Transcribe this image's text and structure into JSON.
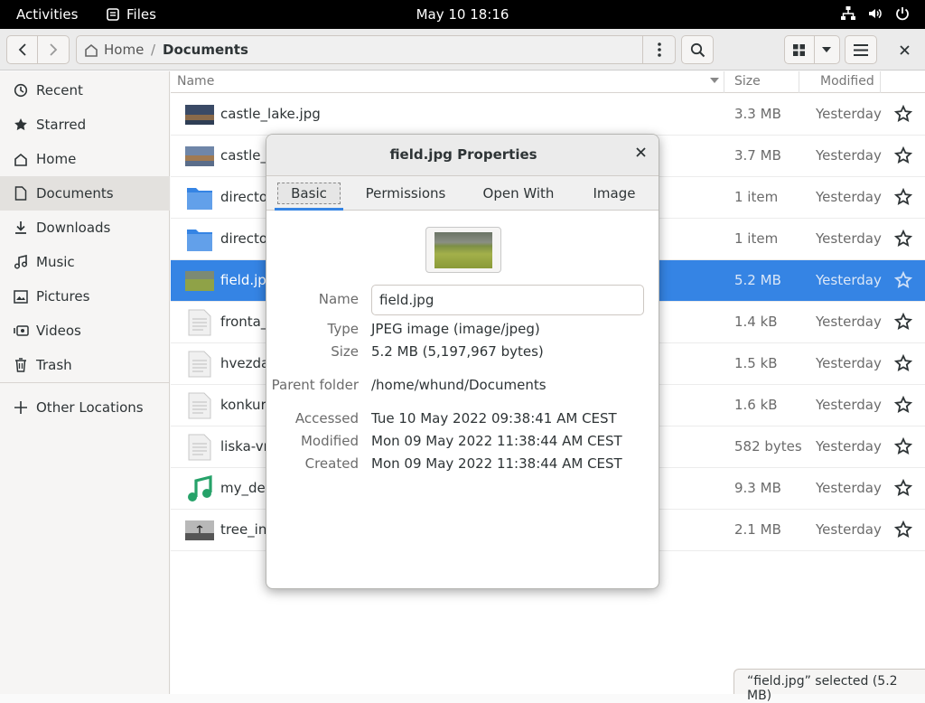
{
  "topbar": {
    "activities": "Activities",
    "app_name": "Files",
    "clock": "May 10  18:16"
  },
  "pathbar": {
    "home": "Home",
    "separator": "/",
    "current": "Documents"
  },
  "sidebar": {
    "items": [
      {
        "label": "Recent",
        "icon": "clock-icon"
      },
      {
        "label": "Starred",
        "icon": "star-icon"
      },
      {
        "label": "Home",
        "icon": "home-icon"
      },
      {
        "label": "Documents",
        "icon": "document-icon"
      },
      {
        "label": "Downloads",
        "icon": "download-icon"
      },
      {
        "label": "Music",
        "icon": "music-icon"
      },
      {
        "label": "Pictures",
        "icon": "picture-icon"
      },
      {
        "label": "Videos",
        "icon": "video-icon"
      },
      {
        "label": "Trash",
        "icon": "trash-icon"
      }
    ],
    "other_locations": "Other Locations"
  },
  "columns": {
    "name": "Name",
    "size": "Size",
    "modified": "Modified"
  },
  "files": [
    {
      "name": "castle_lake.jpg",
      "size": "3.3 MB",
      "modified": "Yesterday",
      "kind": "image"
    },
    {
      "name": "castle_r",
      "size": "3.7 MB",
      "modified": "Yesterday",
      "kind": "image"
    },
    {
      "name": "director",
      "size": "1 item",
      "modified": "Yesterday",
      "kind": "folder"
    },
    {
      "name": "director",
      "size": "1 item",
      "modified": "Yesterday",
      "kind": "folder"
    },
    {
      "name": "field.jpg",
      "size": "5.2 MB",
      "modified": "Yesterday",
      "kind": "image"
    },
    {
      "name": "fronta_r",
      "size": "1.4 kB",
      "modified": "Yesterday",
      "kind": "text"
    },
    {
      "name": "hvezdar",
      "size": "1.5 kB",
      "modified": "Yesterday",
      "kind": "text"
    },
    {
      "name": "konkurz",
      "size": "1.6 kB",
      "modified": "Yesterday",
      "kind": "text"
    },
    {
      "name": "liska-vr",
      "size": "582 bytes",
      "modified": "Yesterday",
      "kind": "text"
    },
    {
      "name": "my_dea",
      "size": "9.3 MB",
      "modified": "Yesterday",
      "kind": "music"
    },
    {
      "name": "tree_in_",
      "size": "2.1 MB",
      "modified": "Yesterday",
      "kind": "image"
    }
  ],
  "status": "“field.jpg” selected  (5.2 MB)",
  "dialog": {
    "title": "field.jpg Properties",
    "tabs": [
      "Basic",
      "Permissions",
      "Open With",
      "Image"
    ],
    "labels": {
      "name": "Name",
      "type": "Type",
      "size": "Size",
      "parent": "Parent folder",
      "accessed": "Accessed",
      "modified": "Modified",
      "created": "Created"
    },
    "values": {
      "name": "field.jpg",
      "type": "JPEG image (image/jpeg)",
      "size": "5.2 MB (5,197,967 bytes)",
      "parent": "/home/whund/Documents",
      "accessed": "Tue 10 May 2022 09:38:41 AM CEST",
      "modified": "Mon 09 May 2022 11:38:44 AM CEST",
      "created": "Mon 09 May 2022 11:38:44 AM CEST"
    }
  }
}
